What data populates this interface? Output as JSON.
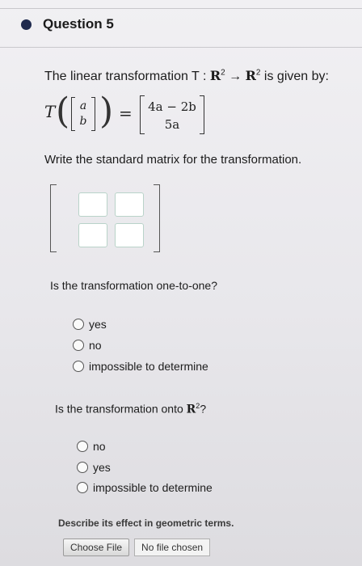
{
  "question": {
    "title": "Question 5"
  },
  "prompt": {
    "prefix": "The linear transformation T :",
    "domain": "R",
    "domain_exp": "2",
    "arrow": "→",
    "codomain": "R",
    "codomain_exp": "2",
    "suffix": "is given by:"
  },
  "formula": {
    "func": "T",
    "input_top": "a",
    "input_bottom": "b",
    "equals": "=",
    "output_top": "4a − 2b",
    "output_bottom": "5a"
  },
  "instruction": "Write the standard matrix for the transformation.",
  "matrix_inputs": [
    "",
    "",
    "",
    ""
  ],
  "one_to_one": {
    "question": "Is the transformation one-to-one?",
    "options": [
      "yes",
      "no",
      "impossible to determine"
    ]
  },
  "onto": {
    "question_prefix": "Is the transformation onto",
    "space": "R",
    "space_exp": "2",
    "question_suffix": "?",
    "options": [
      "no",
      "yes",
      "impossible to determine"
    ]
  },
  "describe": {
    "label": "Describe its effect in geometric terms.",
    "button": "Choose File",
    "status": "No file chosen"
  }
}
